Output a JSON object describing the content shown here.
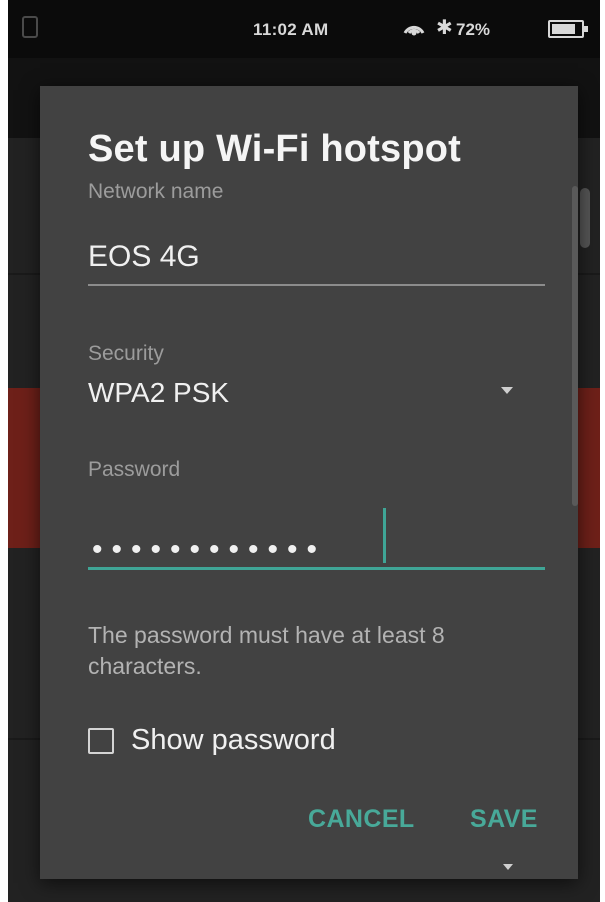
{
  "status_bar": {
    "time": "11:02 AM",
    "battery": "72%",
    "icons": [
      "sim-icon",
      "hotspot-icon",
      "bluetooth-icon",
      "battery-icon"
    ]
  },
  "dialog": {
    "title": "Set up Wi-Fi hotspot",
    "network_name": {
      "label": "Network name",
      "value": "EOS 4G"
    },
    "security": {
      "label": "Security",
      "value": "WPA2 PSK"
    },
    "password": {
      "label": "Password",
      "value_masked": "••••••••••••",
      "hint": "The password must have at least 8 characters."
    },
    "show_password": {
      "label": "Show password",
      "checked": false
    },
    "buttons": {
      "cancel": "CANCEL",
      "save": "SAVE"
    }
  },
  "colors": {
    "accent": "#48a999",
    "dialog_bg": "#424242",
    "background_red": "#6e2019"
  }
}
